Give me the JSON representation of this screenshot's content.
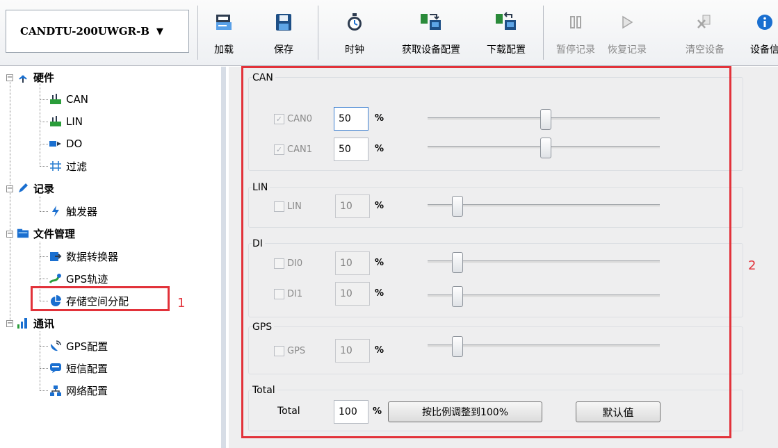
{
  "toolbar": {
    "device": "CANDTU-200UWGR-B",
    "buttons": [
      {
        "label": "加载",
        "icon": "folder-open-icon"
      },
      {
        "label": "保存",
        "icon": "floppy-save-icon"
      },
      {
        "label": "时钟",
        "icon": "stopwatch-icon"
      },
      {
        "label": "获取设备配置",
        "icon": "device-read-icon"
      },
      {
        "label": "下载配置",
        "icon": "device-download-icon"
      },
      {
        "label": "暂停记录",
        "icon": "pause-icon"
      },
      {
        "label": "恢复记录",
        "icon": "resume-icon"
      },
      {
        "label": "清空设备",
        "icon": "clear-device-icon"
      },
      {
        "label": "设备信",
        "icon": "info-icon"
      }
    ]
  },
  "tree": {
    "hardware": {
      "label": "硬件",
      "children": [
        "CAN",
        "LIN",
        "DO",
        "过滤"
      ]
    },
    "record": {
      "label": "记录",
      "children": [
        "触发器"
      ]
    },
    "files": {
      "label": "文件管理",
      "children": [
        "数据转换器",
        "GPS轨迹",
        "存储空间分配"
      ]
    },
    "comm": {
      "label": "通讯",
      "children": [
        "GPS配置",
        "短信配置",
        "网络配置"
      ]
    }
  },
  "panel": {
    "can": {
      "title": "CAN",
      "rows": [
        {
          "label": "CAN0",
          "value": "50",
          "unit": "%",
          "checked": true,
          "slider": 50
        },
        {
          "label": "CAN1",
          "value": "50",
          "unit": "%",
          "checked": true,
          "slider": 50
        }
      ]
    },
    "lin": {
      "title": "LIN",
      "rows": [
        {
          "label": "LIN",
          "value": "10",
          "unit": "%",
          "checked": false,
          "slider": 10
        }
      ]
    },
    "di": {
      "title": "DI",
      "rows": [
        {
          "label": "DI0",
          "value": "10",
          "unit": "%",
          "checked": false,
          "slider": 10
        },
        {
          "label": "DI1",
          "value": "10",
          "unit": "%",
          "checked": false,
          "slider": 10
        }
      ]
    },
    "gps": {
      "title": "GPS",
      "rows": [
        {
          "label": "GPS",
          "value": "10",
          "unit": "%",
          "checked": false,
          "slider": 10
        }
      ]
    },
    "total": {
      "title": "Total",
      "label": "Total",
      "value": "100",
      "unit": "%",
      "scale_button": "按比例调整到100%",
      "default_button": "默认值"
    }
  },
  "annotations": {
    "one": "1",
    "two": "2"
  },
  "colors": {
    "highlight": "#e2323a",
    "accent": "#1a6fd0"
  }
}
